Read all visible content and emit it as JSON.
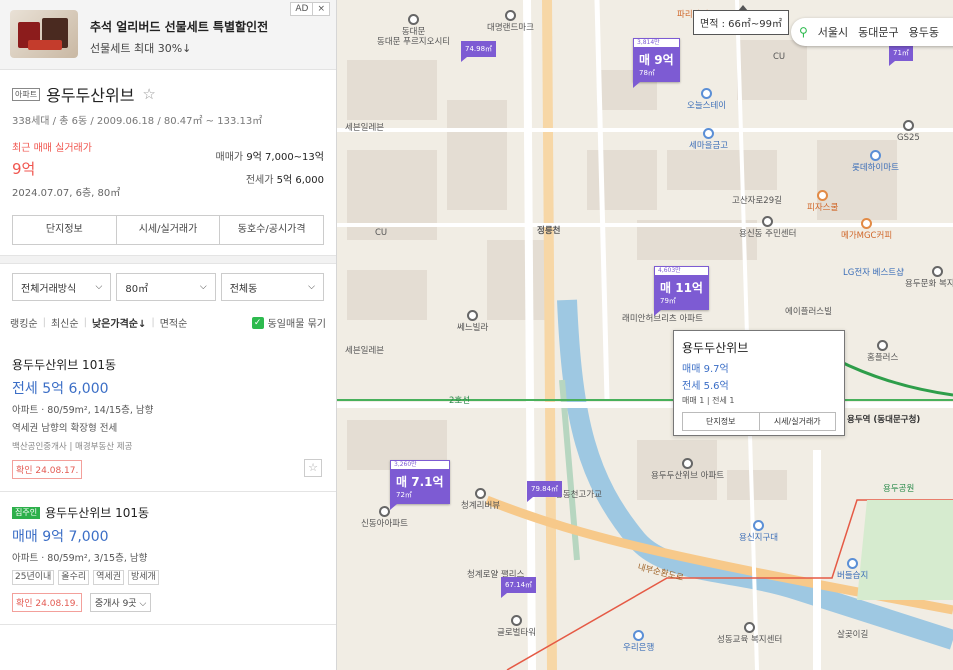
{
  "ad": {
    "title": "추석 얼리버드 선물세트 특별할인전",
    "subtitle": "선물세트 최대 30%↓",
    "tag": "AD",
    "close": "×"
  },
  "complex": {
    "type_badge": "아파트",
    "name": "용두두산위브",
    "star": "☆",
    "meta": "338세대 / 총 6동 / 2009.06.18 / 80.47㎡ ~ 133.13㎡",
    "recent_label": "최근 매매 실거래가",
    "recent_price": "9억",
    "recent_date": "2024.07.07, 6층, 80㎡",
    "sale_label": "매매가",
    "sale_range": "9억 7,000~13억",
    "jeonse_label": "전세가",
    "jeonse_value": "5억 6,000",
    "tabs": [
      "단지정보",
      "시세/실거래가",
      "동호수/공시가격"
    ]
  },
  "filters": {
    "trade_type": "전체거래방식",
    "area": "80㎡",
    "building": "전체동"
  },
  "sort": {
    "items": [
      "랭킹순",
      "최신순",
      "낮은가격순↓",
      "면적순"
    ],
    "active_index": 2,
    "dedupe_label": "동일매물 묶기",
    "dedupe_checked": true
  },
  "listings": [
    {
      "title": "용두두산위브 101동",
      "badge": "",
      "price": "전세 5억 6,000",
      "spec": "아파트 · 80/59m², 14/15층, 남향",
      "desc": "역세권 남향의 확장형 전세",
      "agent": "백산공인중개사 | 매경부동산 제공",
      "confirmed": "확인 24.08.17.",
      "tags": [],
      "agents_btn": ""
    },
    {
      "title": "용두두산위브 101동",
      "badge": "집주인",
      "price": "매매 9억 7,000",
      "spec": "아파트 · 80/59m², 3/15층, 남향",
      "desc": "",
      "agent": "",
      "confirmed": "확인 24.08.19.",
      "tags": [
        "25년이내",
        "올수리",
        "역세권",
        "방세개"
      ],
      "agents_btn": "중개사 9곳 ⌵"
    }
  ],
  "map": {
    "area_tip": "면적 : 66㎡~99㎡",
    "location": [
      "서울시",
      "동대문구",
      "용두동"
    ],
    "markers": [
      {
        "count": "3,814만",
        "price": "매 9억",
        "area": "78㎡"
      },
      {
        "count": "4,603만",
        "price": "매 11억",
        "area": "79㎡"
      },
      {
        "count": "3,260만",
        "price": "매 7.1억",
        "area": "72㎡"
      }
    ],
    "mini_markers": [
      "74.98㎡",
      "79.84㎡",
      "67.14㎡",
      "71㎡"
    ],
    "popup": {
      "title": "용두두산위브",
      "sale": "매매 9.7억",
      "jeonse": "전세 5.6억",
      "counts": "매매 1 | 전세 1",
      "btn1": "단지정보",
      "btn2": "시세/실거래가"
    },
    "pois": [
      "동대문 푸르지오시티",
      "대명랜드마크",
      "파리바게뜨",
      "세븐일레븐",
      "오늘스테이",
      "세마을금고",
      "GS25",
      "롯데하이마트",
      "고산자로29길",
      "피자스쿨",
      "메가MGC커피",
      "용신동 주민센터",
      "정릉천",
      "LG전자 베스트샵",
      "용두문화 복지센터",
      "에이플러스빌",
      "세븐일레븐",
      "쎄느빌라",
      "래미안허브리츠 아파트",
      "홈플러스",
      "용두역 (동대문구청)",
      "용두두산위브 아파트",
      "청계리버뷰",
      "성동천고가교",
      "신동아아파트",
      "용신지구대",
      "내부순환도로",
      "청계로얄 팰리스",
      "용두공원",
      "버들습지",
      "글로벌타워",
      "우리은행",
      "성동교육 복지센터",
      "살곶이길",
      "CU",
      "CU",
      "2호선",
      "동대문"
    ]
  }
}
